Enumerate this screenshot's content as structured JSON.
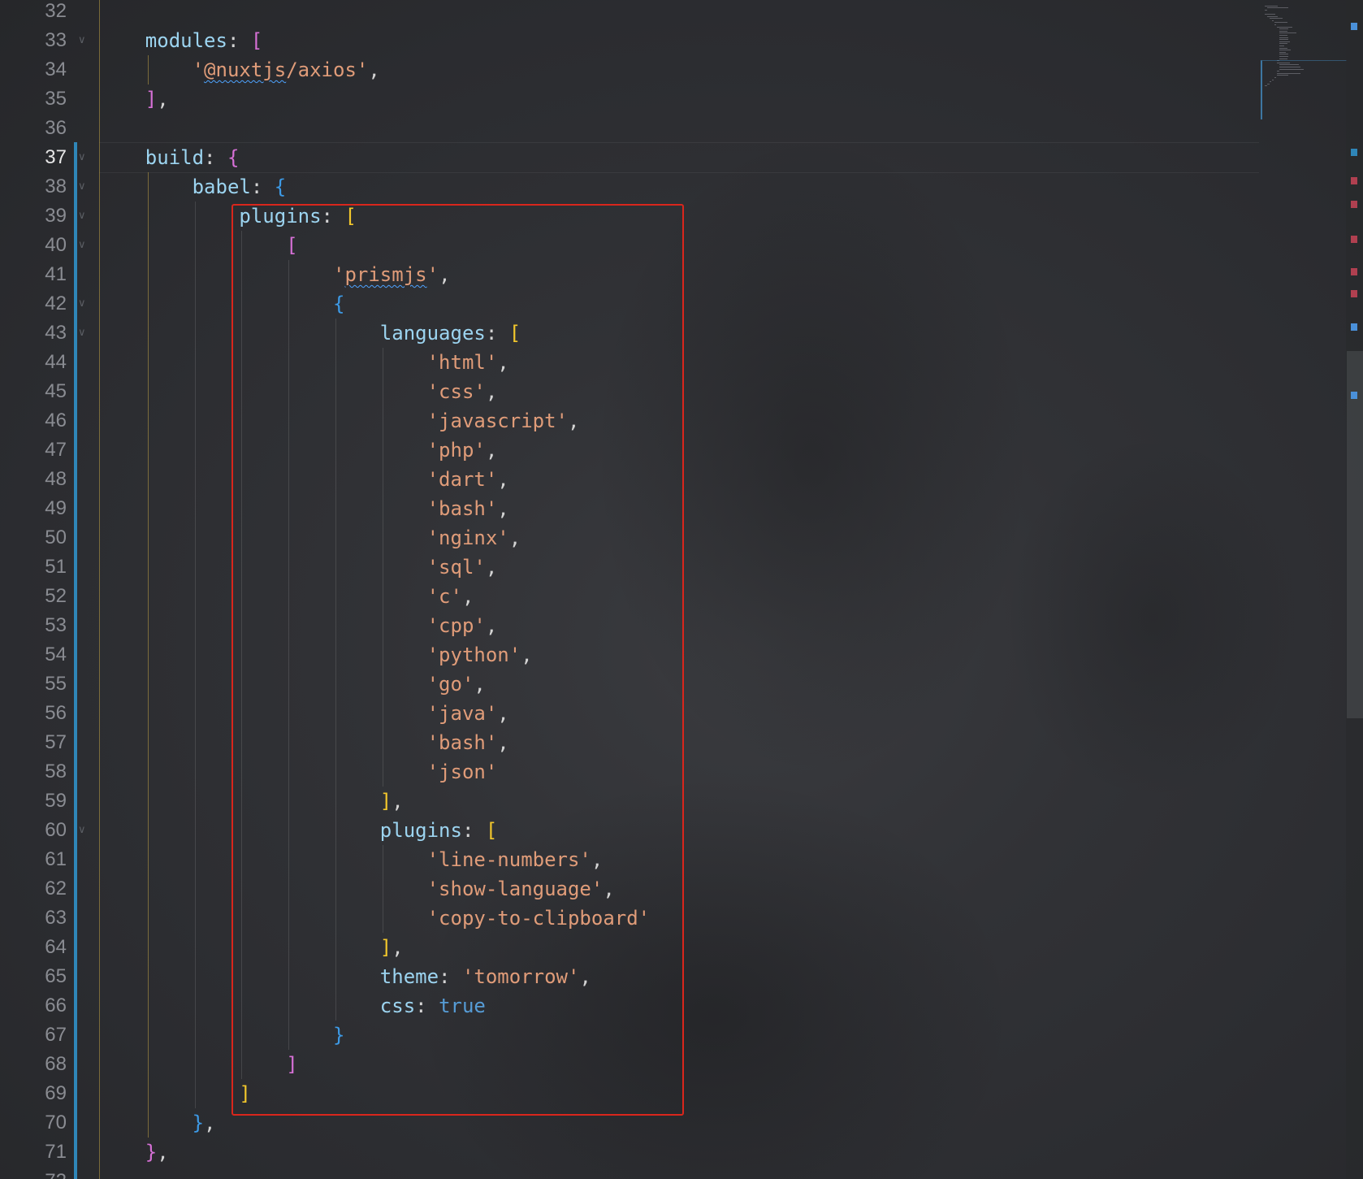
{
  "editor": {
    "active_line": 37,
    "lines": [
      {
        "num": "32",
        "indent": 0,
        "fold": false,
        "tokens": []
      },
      {
        "num": "33",
        "indent": 1,
        "fold": true,
        "tokens": [
          {
            "t": "modules",
            "c": "key"
          },
          {
            "t": ": ",
            "c": "punct"
          },
          {
            "t": "[",
            "c": "br-pink"
          }
        ]
      },
      {
        "num": "34",
        "indent": 2,
        "fold": false,
        "tokens": [
          {
            "t": "'",
            "c": "str"
          },
          {
            "t": "@nuxtjs",
            "c": "str",
            "squiggle": true
          },
          {
            "t": "/axios'",
            "c": "str"
          },
          {
            "t": ",",
            "c": "punct"
          }
        ]
      },
      {
        "num": "35",
        "indent": 1,
        "fold": false,
        "tokens": [
          {
            "t": "]",
            "c": "br-pink"
          },
          {
            "t": ",",
            "c": "punct"
          }
        ]
      },
      {
        "num": "36",
        "indent": 0,
        "fold": false,
        "tokens": []
      },
      {
        "num": "37",
        "indent": 1,
        "fold": true,
        "tokens": [
          {
            "t": "build",
            "c": "key"
          },
          {
            "t": ": ",
            "c": "punct"
          },
          {
            "t": "{",
            "c": "br-pink"
          }
        ]
      },
      {
        "num": "38",
        "indent": 2,
        "fold": true,
        "tokens": [
          {
            "t": "babel",
            "c": "key"
          },
          {
            "t": ": ",
            "c": "punct"
          },
          {
            "t": "{",
            "c": "br-blue"
          }
        ]
      },
      {
        "num": "39",
        "indent": 3,
        "fold": true,
        "tokens": [
          {
            "t": "plugins",
            "c": "key"
          },
          {
            "t": ": ",
            "c": "punct"
          },
          {
            "t": "[",
            "c": "br-yellow"
          }
        ]
      },
      {
        "num": "40",
        "indent": 4,
        "fold": true,
        "tokens": [
          {
            "t": "[",
            "c": "br-pink"
          }
        ]
      },
      {
        "num": "41",
        "indent": 5,
        "fold": false,
        "tokens": [
          {
            "t": "'",
            "c": "str"
          },
          {
            "t": "prismjs",
            "c": "str",
            "squiggle": true
          },
          {
            "t": "'",
            "c": "str"
          },
          {
            "t": ",",
            "c": "punct"
          }
        ]
      },
      {
        "num": "42",
        "indent": 5,
        "fold": true,
        "tokens": [
          {
            "t": "{",
            "c": "br-blue"
          }
        ]
      },
      {
        "num": "43",
        "indent": 6,
        "fold": true,
        "tokens": [
          {
            "t": "languages",
            "c": "key"
          },
          {
            "t": ": ",
            "c": "punct"
          },
          {
            "t": "[",
            "c": "br-yellow"
          }
        ]
      },
      {
        "num": "44",
        "indent": 7,
        "fold": false,
        "tokens": [
          {
            "t": "'html'",
            "c": "str"
          },
          {
            "t": ",",
            "c": "punct"
          }
        ]
      },
      {
        "num": "45",
        "indent": 7,
        "fold": false,
        "tokens": [
          {
            "t": "'css'",
            "c": "str"
          },
          {
            "t": ",",
            "c": "punct"
          }
        ]
      },
      {
        "num": "46",
        "indent": 7,
        "fold": false,
        "tokens": [
          {
            "t": "'javascript'",
            "c": "str"
          },
          {
            "t": ",",
            "c": "punct"
          }
        ]
      },
      {
        "num": "47",
        "indent": 7,
        "fold": false,
        "tokens": [
          {
            "t": "'php'",
            "c": "str"
          },
          {
            "t": ",",
            "c": "punct"
          }
        ]
      },
      {
        "num": "48",
        "indent": 7,
        "fold": false,
        "tokens": [
          {
            "t": "'dart'",
            "c": "str"
          },
          {
            "t": ",",
            "c": "punct"
          }
        ]
      },
      {
        "num": "49",
        "indent": 7,
        "fold": false,
        "tokens": [
          {
            "t": "'bash'",
            "c": "str"
          },
          {
            "t": ",",
            "c": "punct"
          }
        ]
      },
      {
        "num": "50",
        "indent": 7,
        "fold": false,
        "tokens": [
          {
            "t": "'nginx'",
            "c": "str"
          },
          {
            "t": ",",
            "c": "punct"
          }
        ]
      },
      {
        "num": "51",
        "indent": 7,
        "fold": false,
        "tokens": [
          {
            "t": "'sql'",
            "c": "str"
          },
          {
            "t": ",",
            "c": "punct"
          }
        ]
      },
      {
        "num": "52",
        "indent": 7,
        "fold": false,
        "tokens": [
          {
            "t": "'c'",
            "c": "str"
          },
          {
            "t": ",",
            "c": "punct"
          }
        ]
      },
      {
        "num": "53",
        "indent": 7,
        "fold": false,
        "tokens": [
          {
            "t": "'cpp'",
            "c": "str"
          },
          {
            "t": ",",
            "c": "punct"
          }
        ]
      },
      {
        "num": "54",
        "indent": 7,
        "fold": false,
        "tokens": [
          {
            "t": "'python'",
            "c": "str"
          },
          {
            "t": ",",
            "c": "punct"
          }
        ]
      },
      {
        "num": "55",
        "indent": 7,
        "fold": false,
        "tokens": [
          {
            "t": "'go'",
            "c": "str"
          },
          {
            "t": ",",
            "c": "punct"
          }
        ]
      },
      {
        "num": "56",
        "indent": 7,
        "fold": false,
        "tokens": [
          {
            "t": "'java'",
            "c": "str"
          },
          {
            "t": ",",
            "c": "punct"
          }
        ]
      },
      {
        "num": "57",
        "indent": 7,
        "fold": false,
        "tokens": [
          {
            "t": "'bash'",
            "c": "str"
          },
          {
            "t": ",",
            "c": "punct"
          }
        ]
      },
      {
        "num": "58",
        "indent": 7,
        "fold": false,
        "tokens": [
          {
            "t": "'json'",
            "c": "str"
          }
        ]
      },
      {
        "num": "59",
        "indent": 6,
        "fold": false,
        "tokens": [
          {
            "t": "]",
            "c": "br-yellow"
          },
          {
            "t": ",",
            "c": "punct"
          }
        ]
      },
      {
        "num": "60",
        "indent": 6,
        "fold": true,
        "tokens": [
          {
            "t": "plugins",
            "c": "key"
          },
          {
            "t": ": ",
            "c": "punct"
          },
          {
            "t": "[",
            "c": "br-yellow"
          }
        ]
      },
      {
        "num": "61",
        "indent": 7,
        "fold": false,
        "tokens": [
          {
            "t": "'line-numbers'",
            "c": "str"
          },
          {
            "t": ",",
            "c": "punct"
          }
        ]
      },
      {
        "num": "62",
        "indent": 7,
        "fold": false,
        "tokens": [
          {
            "t": "'show-language'",
            "c": "str"
          },
          {
            "t": ",",
            "c": "punct"
          }
        ]
      },
      {
        "num": "63",
        "indent": 7,
        "fold": false,
        "tokens": [
          {
            "t": "'copy-to-clipboard'",
            "c": "str"
          }
        ]
      },
      {
        "num": "64",
        "indent": 6,
        "fold": false,
        "tokens": [
          {
            "t": "]",
            "c": "br-yellow"
          },
          {
            "t": ",",
            "c": "punct"
          }
        ]
      },
      {
        "num": "65",
        "indent": 6,
        "fold": false,
        "tokens": [
          {
            "t": "theme",
            "c": "key"
          },
          {
            "t": ": ",
            "c": "punct"
          },
          {
            "t": "'tomorrow'",
            "c": "str"
          },
          {
            "t": ",",
            "c": "punct"
          }
        ]
      },
      {
        "num": "66",
        "indent": 6,
        "fold": false,
        "tokens": [
          {
            "t": "css",
            "c": "key"
          },
          {
            "t": ": ",
            "c": "punct"
          },
          {
            "t": "true",
            "c": "bool"
          }
        ]
      },
      {
        "num": "67",
        "indent": 5,
        "fold": false,
        "tokens": [
          {
            "t": "}",
            "c": "br-blue"
          }
        ]
      },
      {
        "num": "68",
        "indent": 4,
        "fold": false,
        "tokens": [
          {
            "t": "]",
            "c": "br-pink"
          }
        ]
      },
      {
        "num": "69",
        "indent": 3,
        "fold": false,
        "tokens": [
          {
            "t": "]",
            "c": "br-yellow"
          }
        ]
      },
      {
        "num": "70",
        "indent": 2,
        "fold": false,
        "tokens": [
          {
            "t": "}",
            "c": "br-blue"
          },
          {
            "t": ",",
            "c": "punct"
          }
        ]
      },
      {
        "num": "71",
        "indent": 1,
        "fold": false,
        "tokens": [
          {
            "t": "}",
            "c": "br-pink"
          },
          {
            "t": ",",
            "c": "punct"
          }
        ]
      },
      {
        "num": "72",
        "indent": 0,
        "fold": false,
        "tokens": []
      }
    ]
  },
  "colors": {
    "key": "#9cd4f0",
    "string": "#e09c79",
    "bracket_pink": "#d670d6",
    "bracket_yellow": "#f2c72c",
    "bracket_blue": "#3d9ae6",
    "boolean": "#569cd6",
    "highlight_box": "#d9261c",
    "change_bar": "#2f86b8"
  },
  "icons": {
    "fold": "chevron-down-icon"
  }
}
